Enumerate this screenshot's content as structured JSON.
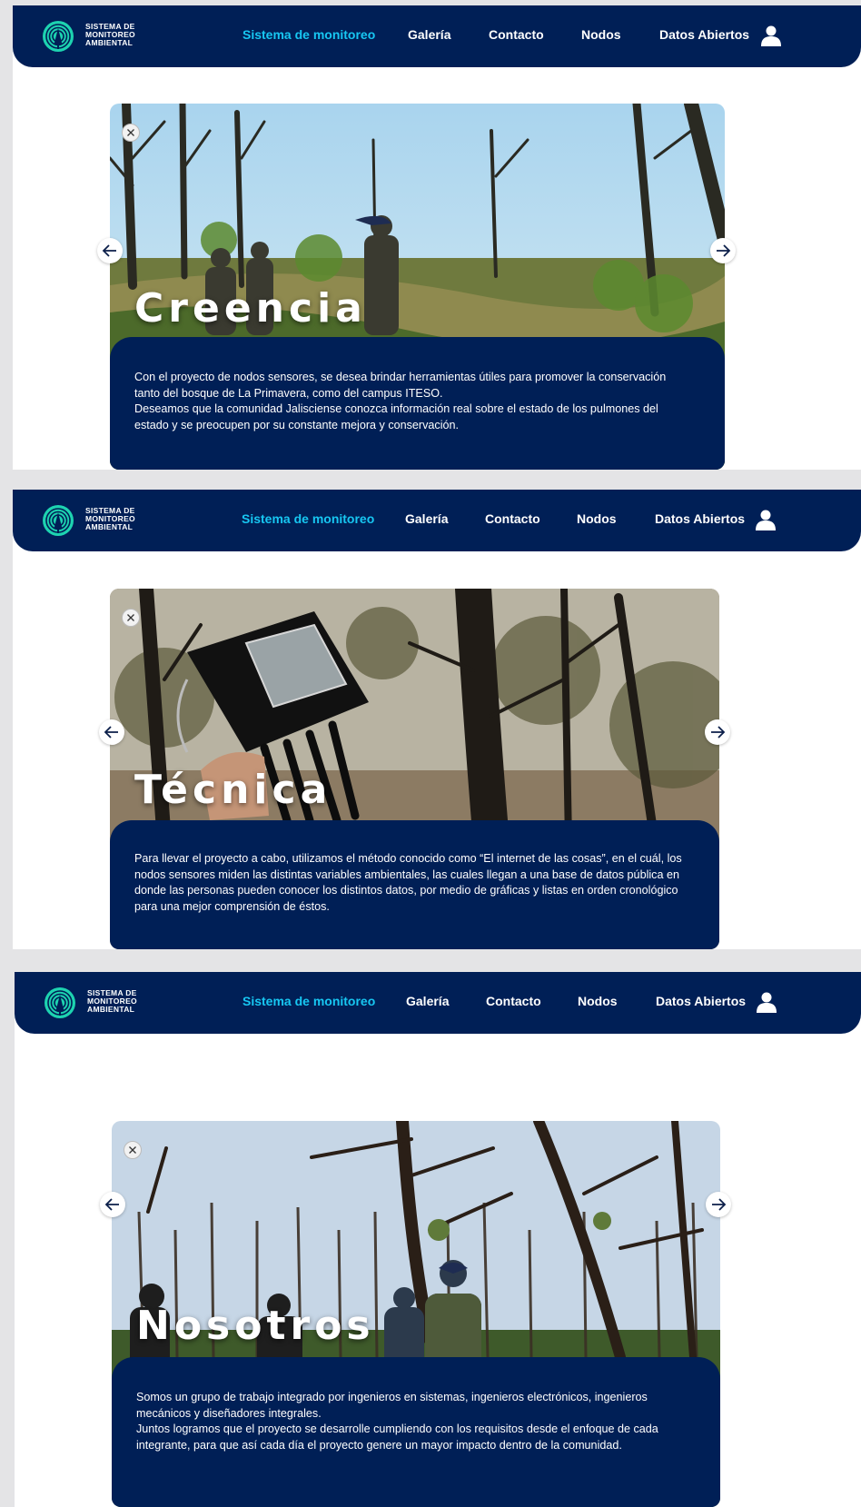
{
  "nav": {
    "logo_line1": "SISTEMA DE",
    "logo_line2": "MONITOREO",
    "logo_line3": "AMBIENTAL",
    "links": [
      "Sistema de monitoreo",
      "Galería",
      "Contacto",
      "Nodos",
      "Datos Abiertos"
    ],
    "user_icon": "user-icon"
  },
  "colors": {
    "navy": "#001f56",
    "accent": "#17c7f2",
    "logo_teal": "#1dd3b0"
  },
  "slides": [
    {
      "title": "Creencia",
      "paragraphs": [
        "Con el proyecto de nodos sensores, se desea brindar herramientas útiles para promover la conservación tanto del bosque de La Primavera, como del campus ITESO.",
        "Deseamos que la comunidad Jalisciense conozca información real sobre el estado de los pulmones del estado y se preocupen por su constante mejora y conservación."
      ]
    },
    {
      "title": "Técnica",
      "paragraphs": [
        "Para llevar el proyecto a cabo, utilizamos el método conocido como “El internet de las cosas”, en el cuál, los nodos sensores miden las distintas variables ambientales, las cuales llegan a una base de datos pública en donde las personas pueden conocer los distintos datos, por medio de gráficas y listas en orden cronológico para una mejor comprensión de éstos."
      ]
    },
    {
      "title": "Nosotros",
      "paragraphs": [
        "Somos un grupo de trabajo integrado por ingenieros en sistemas, ingenieros electrónicos, ingenieros mecánicos y diseñadores integrales.",
        "Juntos logramos que el proyecto se desarrolle cumpliendo con los requisitos desde el enfoque de cada integrante, para que así cada día el proyecto genere un mayor impacto dentro de la comunidad."
      ]
    }
  ]
}
